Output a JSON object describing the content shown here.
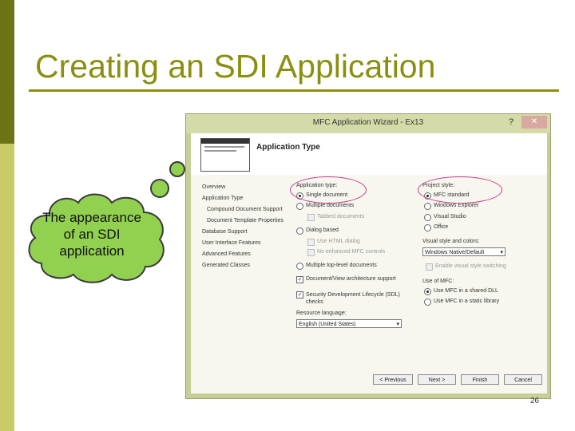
{
  "slide": {
    "title": "Creating an SDI Application",
    "callout": "The appearance of an SDI application",
    "page_number": "26"
  },
  "dialog": {
    "title": "MFC Application Wizard - Ex13",
    "help_label": "?",
    "close_label": "✕",
    "header_title": "Application Type",
    "nav": [
      "Overview",
      "Application Type",
      "Compound Document Support",
      "Document Template Properties",
      "Database Support",
      "User Interface Features",
      "Advanced Features",
      "Generated Classes"
    ],
    "app_type": {
      "label": "Application type:",
      "single": "Single document",
      "multiple": "Multiple documents",
      "tabbed": "Tabbed documents",
      "dialog": "Dialog based",
      "use_html": "Use HTML dialog",
      "no_enhanced": "No enhanced MFC controls",
      "multiple_top": "Multiple top-level documents",
      "doc_view": "Document/View architecture support",
      "sdl": "Security Development Lifecycle (SDL) checks",
      "resource_label": "Resource language:",
      "resource_value": "English (United States)"
    },
    "project_style": {
      "label": "Project style:",
      "mfc_standard": "MFC standard",
      "windows_explorer": "Windows Explorer",
      "visual_studio": "Visual Studio",
      "office": "Office",
      "visual_style_label": "Visual style and colors:",
      "visual_style_value": "Windows Native/Default",
      "enable_switching": "Enable visual style switching",
      "use_mfc_label": "Use of MFC:",
      "shared_dll": "Use MFC in a shared DLL",
      "static_library": "Use MFC in a static library"
    },
    "buttons": {
      "previous": "< Previous",
      "next": "Next >",
      "finish": "Finish",
      "cancel": "Cancel"
    }
  }
}
